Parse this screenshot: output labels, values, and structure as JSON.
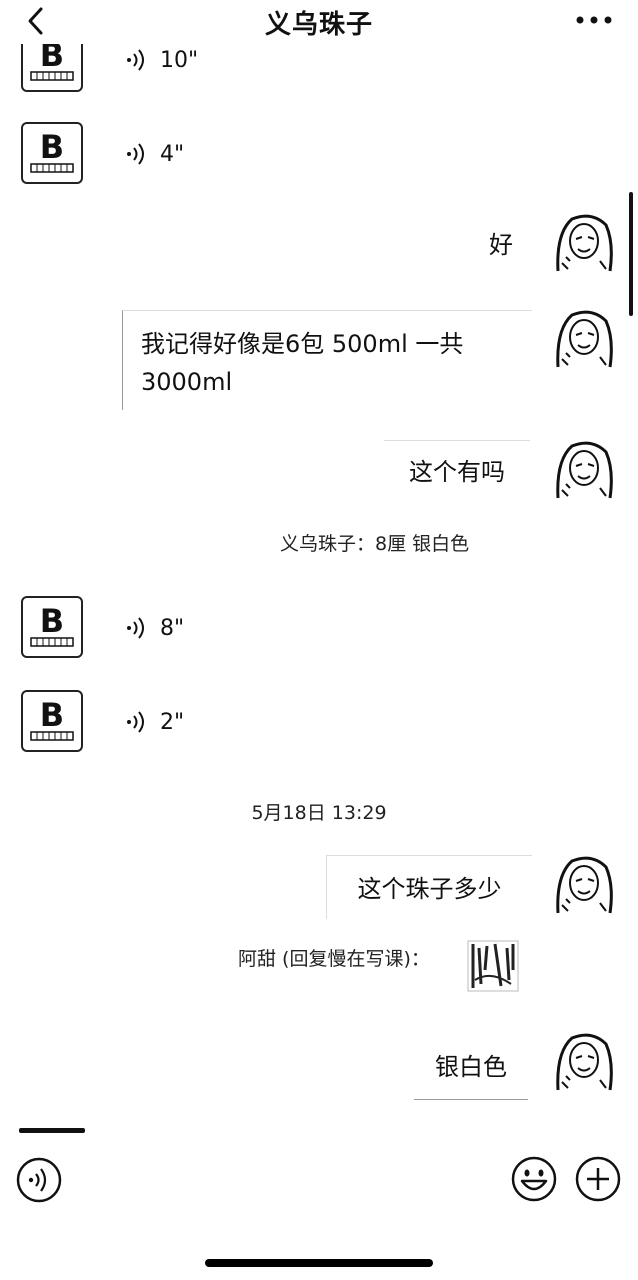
{
  "header": {
    "title": "义乌珠子"
  },
  "messages": {
    "voice_1": {
      "duration": "10\""
    },
    "voice_2": {
      "duration": "4\""
    },
    "text_hao": "好",
    "text_remember_line1": "我记得好像是6包 500ml 一共",
    "text_remember_line2": "3000ml",
    "text_youma": "这个有吗",
    "quote_1": "义乌珠子：8厘 银白色",
    "voice_3": {
      "duration": "8\""
    },
    "voice_4": {
      "duration": "2\""
    },
    "timestamp": "5月18日 13:29",
    "text_price": "这个珠子多少",
    "quote_2": "阿甜 (回复慢在写课)：",
    "text_silver": "银白色"
  },
  "icons": {
    "back": "chevron-left-icon",
    "more": "more-dots-icon",
    "voice_wave": "voice-wave-icon",
    "voice_input": "voice-input-icon",
    "emoji": "emoji-icon",
    "plus": "plus-icon"
  }
}
